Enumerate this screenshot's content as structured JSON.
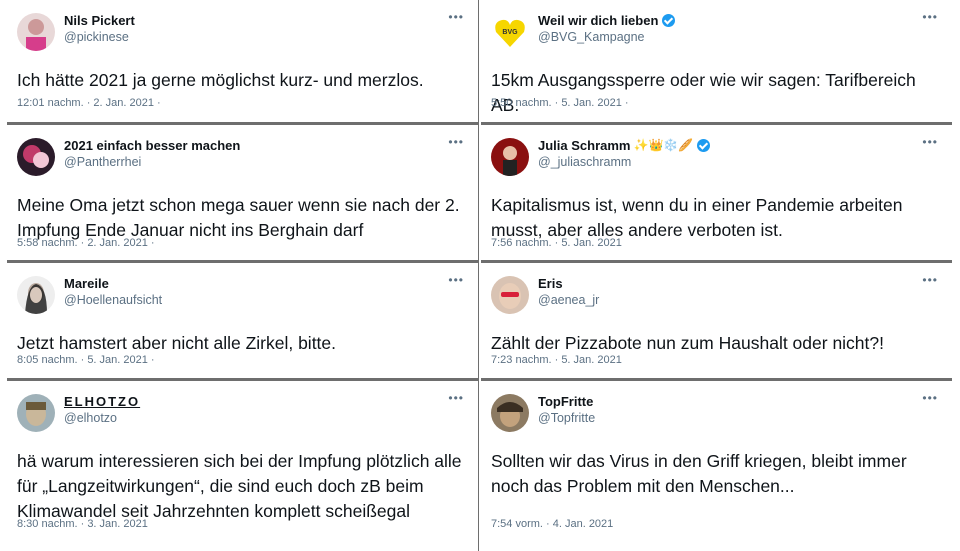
{
  "tweets_left": [
    {
      "name": "Nils Pickert",
      "handle": "@pickinese",
      "text": "Ich hätte 2021 ja gerne möglichst kurz- und merzlos.",
      "meta": "12:01 nachm. · 2. Jan. 2021 ·"
    },
    {
      "name": "2021 einfach besser machen",
      "handle": "@Pantherrhei",
      "text": "Meine Oma jetzt schon mega sauer wenn sie nach der 2. Impfung Ende Januar nicht ins Berghain darf",
      "meta": "5:58 nachm. · 2. Jan. 2021 ·"
    },
    {
      "name": "Mareile",
      "handle": "@Hoellenaufsicht",
      "text": "Jetzt hamstert aber nicht alle Zirkel, bitte.",
      "meta": "8:05 nachm. · 5. Jan. 2021 ·"
    },
    {
      "name": "ELHOTZO",
      "handle": "@elhotzo",
      "text": "hä warum interessieren sich bei der Impfung plötzlich alle für „Langzeitwirkungen“, die sind euch doch zB beim Klimawandel seit Jahrzehnten komplett scheißegal",
      "meta": "8:30 nachm. · 3. Jan. 2021"
    }
  ],
  "tweets_right": [
    {
      "name": "Weil wir dich lieben",
      "handle": "@BVG_Kampagne",
      "text": "15km Ausgangssperre oder wie wir sagen: Tarifbereich AB.",
      "meta": "5:50 nachm. · 5. Jan. 2021 ·"
    },
    {
      "name": "Julia Schramm",
      "handle": "@_juliaschramm",
      "text": "Kapitalismus ist, wenn du in einer Pandemie arbeiten musst, aber alles andere verboten ist.",
      "meta": "7:56 nachm. · 5. Jan. 2021",
      "emoji": "✨👑❄️🥖"
    },
    {
      "name": "Eris",
      "handle": "@aenea_jr",
      "text": "Zählt der Pizzabote nun zum Haushalt oder nicht?!",
      "meta": "7:23 nachm. · 5. Jan. 2021"
    },
    {
      "name": "TopFritte",
      "handle": "@Topfritte",
      "text": "Sollten wir das Virus in den Griff kriegen, bleibt immer noch das Problem mit den Menschen...",
      "meta": "7:54 vorm. · 4. Jan. 2021"
    }
  ],
  "more_label": "•••",
  "colors": {
    "verified": "#1d9bf0",
    "handle": "#5b7083",
    "divider": "#6e6e6e"
  }
}
